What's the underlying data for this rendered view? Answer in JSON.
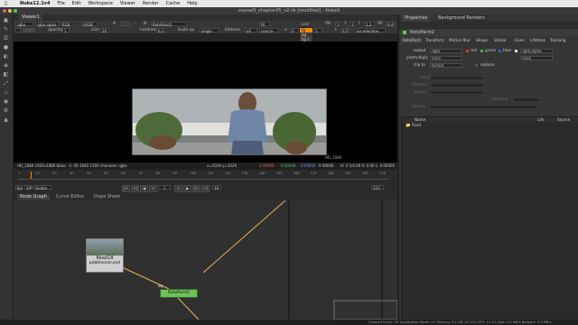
{
  "menubar": {
    "app": "Nuke12.1v4",
    "items": [
      "File",
      "Edit",
      "Workspace",
      "Viewer",
      "Render",
      "Cache",
      "Help"
    ]
  },
  "window": {
    "title": "course5_chapter05_v2.nk [modified] - NukeX"
  },
  "viewer": {
    "tab": "Viewer1",
    "row1": {
      "channels": "rgba",
      "alpha": "rgba.alpha",
      "colorspace": "RGB",
      "input": "sRGB",
      "node": "RotoPaint2",
      "zoom": "fit",
      "ff": "f/8",
      "gain": "1",
      "y": "Y",
      "y_val": "1",
      "f_label": "f",
      "stop": "2.2",
      "sp": "SP",
      "sp_val": "0.4"
    },
    "row2": {
      "opacity_label": "opacity",
      "opacity": "1",
      "size_label": "size",
      "size": "20",
      "hardness_label": "hardness",
      "hardness": "0.2",
      "buildup_label": "build up",
      "source": "single",
      "lifetime_label": "lifetime",
      "lifetime": "all",
      "mode": "source",
      "v_label": "v",
      "v": "0",
      "color_label": "color",
      "color": "1",
      "t_label": "t",
      "t": "0.5"
    },
    "dropdown": {
      "current": "fg",
      "items": [
        "bg",
        "bg 1",
        "bg 2",
        "bg 3"
      ],
      "label": "color"
    },
    "bbox_label": "HD_1080",
    "info": {
      "format": "HD_1080 1920x1080  bbox: -4 -30 1942 1160 channels: rgba",
      "coords": "x=1028 y=1026",
      "r": "0.00000",
      "g": "0.00000",
      "b": "0.00000",
      "a": "0.00000",
      "hsvl": "H: 0 S:0.00 V: 0.00 L: 0.00000"
    }
  },
  "timeline": {
    "ticks": [
      "1",
      "10",
      "20",
      "30",
      "40",
      "50",
      "60",
      "70",
      "80",
      "90",
      "100",
      "110",
      "120",
      "130",
      "140",
      "150",
      "160",
      "170",
      "180",
      "190",
      "200",
      "210"
    ],
    "fps_label": "fps",
    "fps": "24*",
    "mode": "Global",
    "frame": "1",
    "step": "10",
    "end_frame": "210"
  },
  "nodegraph": {
    "tabs": [
      "Node Graph",
      "Curve Editor",
      "Dope Sheet"
    ],
    "read_node": {
      "name": "Read18",
      "file": "pebbleover.psd"
    },
    "roto_node": {
      "name": "RotoPaint2"
    },
    "mask_label": "bg"
  },
  "status": "Channel Count: 26  Localization Mode: On  Memory: 3.1 GB (19.4%)  CPU: 11.1%  Disk: 0.0 MB/s  Network: 0.0 MB/s",
  "properties": {
    "tabs": [
      "Properties",
      "Background Renders"
    ],
    "node_name": "RotoPaint2",
    "subtabs": [
      "RotoPaint",
      "Transform",
      "Motion Blur",
      "Shape",
      "Stroke",
      "Clone",
      "Lifetime",
      "Tracking"
    ],
    "output_label": "output",
    "output": "rgba",
    "output_channels": [
      "red",
      "green",
      "blue",
      "rgba.alpha"
    ],
    "premult_label": "premultiply",
    "premult": "none",
    "premult2": "none",
    "clip_label": "clip to",
    "clip": "format",
    "replace": "replace",
    "dim_rows": [
      "mask",
      "lifetime",
      "source",
      "blending",
      "opacity"
    ],
    "layers_header": [
      "Name",
      "Life",
      "Source"
    ],
    "layer_root": "Root",
    "accent": "#e38a14"
  }
}
